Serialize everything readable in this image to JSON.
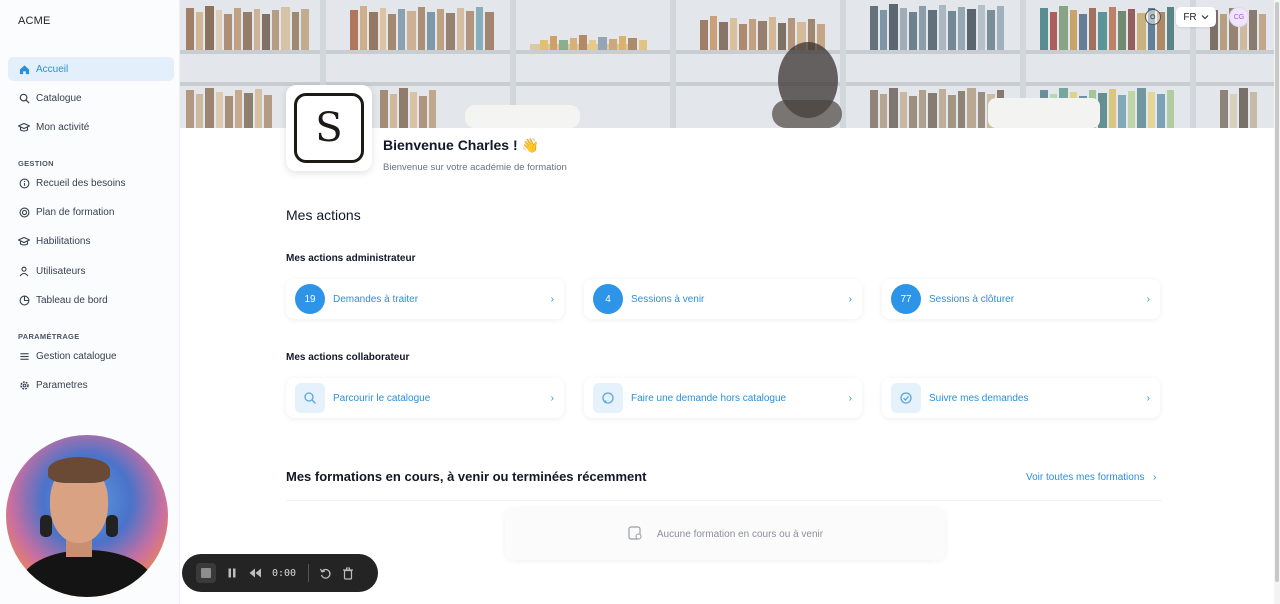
{
  "app": {
    "brand": "ACME"
  },
  "sidebar": {
    "items_top": [
      {
        "label": "Accueil",
        "icon": "home-icon",
        "active": true
      },
      {
        "label": "Catalogue",
        "icon": "search-icon"
      },
      {
        "label": "Mon activité",
        "icon": "graduation-cap-icon"
      }
    ],
    "section_gestion": "GESTION",
    "items_gestion": [
      {
        "label": "Recueil des besoins",
        "icon": "info-circle-icon"
      },
      {
        "label": "Plan de formation",
        "icon": "target-icon"
      },
      {
        "label": "Habilitations",
        "icon": "graduation-cap-icon"
      },
      {
        "label": "Utilisateurs",
        "icon": "users-icon"
      },
      {
        "label": "Tableau de bord",
        "icon": "chart-pie-icon"
      }
    ],
    "section_parametrage": "PARAMÉTRAGE",
    "items_parametrage": [
      {
        "label": "Gestion catalogue",
        "icon": "list-icon"
      },
      {
        "label": "Parametres",
        "icon": "gear-icon"
      }
    ]
  },
  "header": {
    "lang": "FR",
    "avatar_initials": "CG"
  },
  "logo": {
    "letter": "S"
  },
  "welcome": {
    "title": "Bienvenue Charles ! 👋",
    "subtitle": "Bienvenue sur votre académie de formation"
  },
  "actions": {
    "title": "Mes actions",
    "admin_title": "Mes actions administrateur",
    "admin_items": [
      {
        "count": "19",
        "label": "Demandes à traiter"
      },
      {
        "count": "4",
        "label": "Sessions à venir"
      },
      {
        "count": "77",
        "label": "Sessions à clôturer"
      }
    ],
    "collab_title": "Mes actions collaborateur",
    "collab_items": [
      {
        "label": "Parcourir le catalogue",
        "icon": "search-icon"
      },
      {
        "label": "Faire une demande hors catalogue",
        "icon": "chat-icon"
      },
      {
        "label": "Suivre mes demandes",
        "icon": "check-circle-icon"
      }
    ]
  },
  "formations": {
    "title": "Mes formations en cours, à venir ou terminées récemment",
    "link": "Voir toutes mes formations",
    "empty": "Aucune formation en cours ou à venir"
  },
  "recorder": {
    "time": "0:00"
  },
  "colors": {
    "accent": "#2e94e8",
    "link": "#2b8fd8",
    "active_bg": "#e3f0fb"
  }
}
